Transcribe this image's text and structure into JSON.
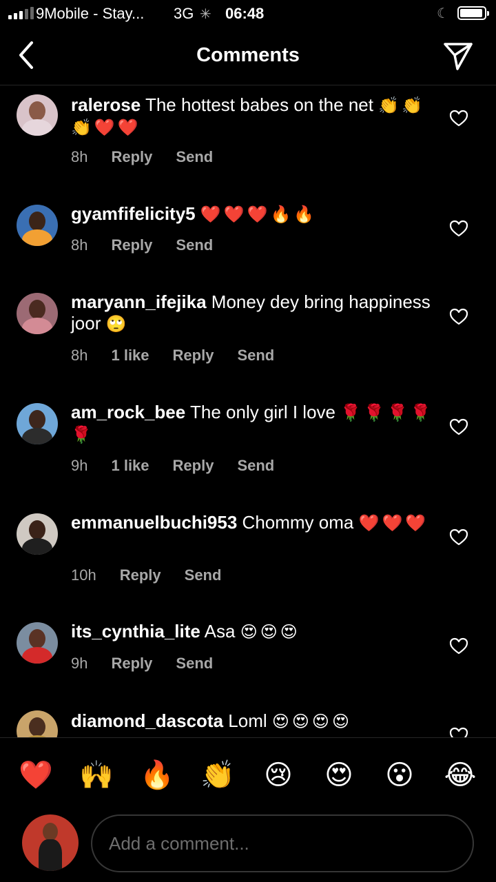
{
  "status_bar": {
    "carrier": "9Mobile - Stay...",
    "network": "3G",
    "time": "06:48"
  },
  "header": {
    "title": "Comments"
  },
  "comments": [
    {
      "username": "ralerose",
      "text": "The hottest babes on the net",
      "emoji": "👏👏👏❤️❤️",
      "time": "8h",
      "likes": "",
      "reply_label": "Reply",
      "send_label": "Send"
    },
    {
      "username": "gyamfifelicity5",
      "text": "",
      "emoji": "❤️❤️❤️🔥🔥",
      "time": "8h",
      "likes": "",
      "reply_label": "Reply",
      "send_label": "Send"
    },
    {
      "username": "maryann_ifejika",
      "text": "Money dey bring happiness joor",
      "emoji": "🙄",
      "time": "8h",
      "likes": "1 like",
      "reply_label": "Reply",
      "send_label": "Send"
    },
    {
      "username": "am_rock_bee",
      "text": "The only girl I love",
      "emoji": "🌹🌹🌹🌹🌹",
      "time": "9h",
      "likes": "1 like",
      "reply_label": "Reply",
      "send_label": "Send"
    },
    {
      "username": "emmanuelbuchi953",
      "text": "Chommy oma",
      "emoji": "❤️❤️❤️",
      "time": "10h",
      "likes": "",
      "reply_label": "Reply",
      "send_label": "Send"
    },
    {
      "username": "its_cynthia_lite",
      "text": "Asa",
      "emoji": "😍😍😍",
      "time": "9h",
      "likes": "",
      "reply_label": "Reply",
      "send_label": "Send"
    },
    {
      "username": "diamond_dascota",
      "text": "Loml",
      "emoji": "😍😍😍😍",
      "time": "",
      "likes": "",
      "reply_label": "",
      "send_label": ""
    }
  ],
  "reactions": [
    "❤️",
    "🙌",
    "🔥",
    "👏",
    "😢",
    "😍",
    "😮",
    "😂"
  ],
  "composer": {
    "placeholder": "Add a comment..."
  },
  "colors": {
    "background": "#000000",
    "secondary_text": "#a8a8a8",
    "divider": "#262626"
  }
}
